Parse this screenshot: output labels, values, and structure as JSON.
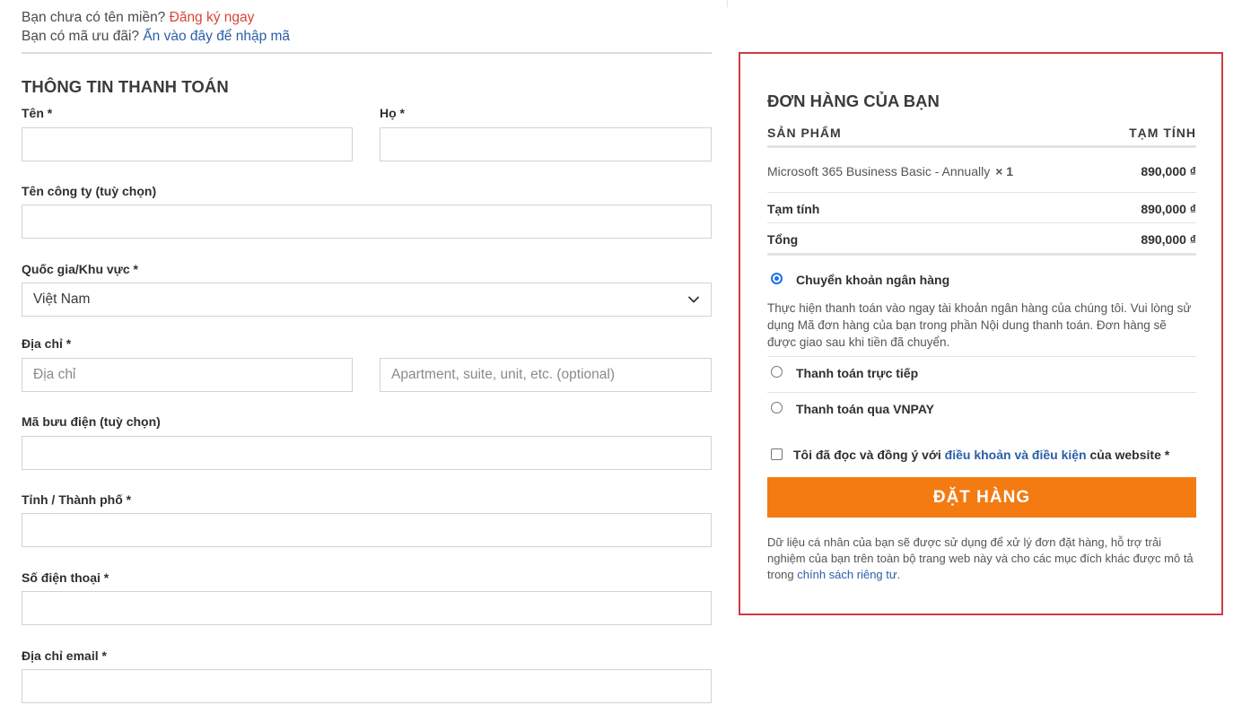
{
  "notices": {
    "domain_question": "Bạn chưa có tên miền?",
    "domain_link": "Đăng ký ngay",
    "coupon_question": "Bạn có mã ưu đãi?",
    "coupon_link": "Ấn vào đây để nhập mã"
  },
  "billing": {
    "title": "THÔNG TIN THANH TOÁN",
    "first_name_label": "Tên *",
    "last_name_label": "Họ *",
    "company_label": "Tên công ty (tuỳ chọn)",
    "country_label": "Quốc gia/Khu vực *",
    "country_value": "Việt Nam",
    "address_label": "Địa chỉ *",
    "address_placeholder": "Địa chỉ",
    "address2_placeholder": "Apartment, suite, unit, etc. (optional)",
    "postcode_label": "Mã bưu điện (tuỳ chọn)",
    "city_label": "Tỉnh / Thành phố *",
    "phone_label": "Số điện thoại *",
    "email_label": "Địa chỉ email *"
  },
  "order": {
    "title": "ĐƠN HÀNG CỦA BẠN",
    "col_product": "SẢN PHẨM",
    "col_subtotal": "TẠM TÍNH",
    "item_name": "Microsoft 365 Business Basic - Annually",
    "item_qty": "× 1",
    "item_price": "890,000 ₫",
    "subtotal_label": "Tạm tính",
    "subtotal_value": "890,000 ₫",
    "total_label": "Tổng",
    "total_value": "890,000 ₫"
  },
  "payment": {
    "bank_transfer": "Chuyển khoản ngân hàng",
    "bank_transfer_desc": "Thực hiện thanh toán vào ngay tài khoản ngân hàng của chúng tôi. Vui lòng sử dụng Mã đơn hàng của bạn trong phần Nội dung thanh toán. Đơn hàng sẽ được giao sau khi tiền đã chuyển.",
    "direct": "Thanh toán trực tiếp",
    "vnpay": "Thanh toán qua VNPAY",
    "selected": "bank_transfer"
  },
  "terms": {
    "prefix": "Tôi đã đọc và đồng ý với",
    "link": "điều khoản và điều kiện",
    "suffix": "của website *"
  },
  "place_order_label": "ĐẶT HÀNG",
  "privacy": {
    "text": "Dữ liệu cá nhân của bạn sẽ được sử dụng để xử lý đơn đặt hàng, hỗ trợ trải nghiệm của bạn trên toàn bộ trang web này và cho các mục đích khác được mô tả trong",
    "link": "chính sách riêng tư",
    "end": "."
  },
  "colors": {
    "accent_orange": "#f47a12",
    "link_red": "#d9443a",
    "link_blue": "#2a5ea9",
    "order_border": "#cf3b45"
  },
  "icons": {
    "country_dropdown": "chevron-down-icon"
  }
}
